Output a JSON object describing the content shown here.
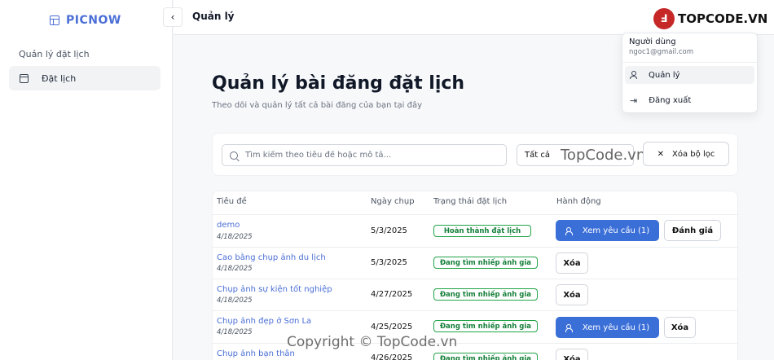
{
  "brand": {
    "name": "PICNOW",
    "icon": "layout-icon"
  },
  "sidebar": {
    "group_label": "Quản lý đặt lịch",
    "items": [
      {
        "label": "Đặt lịch",
        "icon": "calendar-icon"
      }
    ]
  },
  "topbar": {
    "title": "Quản lý",
    "collapse_icon": "chevron-left-icon"
  },
  "watermark": {
    "logo_text": "TOPCODE.VN",
    "logo_mark": "Ⅎ",
    "mid": "TopCode.vn",
    "copyright": "Copyright © TopCode.vn"
  },
  "page": {
    "title": "Quản lý bài đăng đặt lịch",
    "subtitle": "Theo dõi và quản lý tất cả bài đăng của bạn tại đây"
  },
  "filters": {
    "search_placeholder": "Tìm kiếm theo tiêu đề hoặc mô tả...",
    "status_value": "Tất cả",
    "clear_label": "Xóa bộ lọc"
  },
  "table": {
    "headers": [
      "Tiêu đề",
      "Ngày chụp",
      "Trạng thái đặt lịch",
      "Hành động"
    ],
    "rows": [
      {
        "title": "demo",
        "created": "4/18/2025",
        "shoot_date": "5/3/2025",
        "status": "Hoàn thành đặt lịch",
        "actions": [
          "Xem yêu cầu (1)",
          "Đánh giá"
        ]
      },
      {
        "title": "Cao bằng chụp ảnh du lịch",
        "created": "4/18/2025",
        "shoot_date": "5/3/2025",
        "status": "Đang tìm nhiếp ảnh gia",
        "actions": [
          "Xóa"
        ]
      },
      {
        "title": "Chụp ảnh sự kiện tốt nghiệp",
        "created": "4/18/2025",
        "shoot_date": "4/27/2025",
        "status": "Đang tìm nhiếp ảnh gia",
        "actions": [
          "Xóa"
        ]
      },
      {
        "title": "Chụp ảnh đẹp ở Sơn La",
        "created": "4/18/2025",
        "shoot_date": "4/25/2025",
        "status": "Đang tìm nhiếp ảnh gia",
        "actions": [
          "Xem yêu cầu (1)",
          "Xóa"
        ]
      },
      {
        "title": "Chụp ảnh bạn thân",
        "created": "",
        "shoot_date": "4/26/2025",
        "status": "Đang tìm nhiếp ảnh gia",
        "actions": [
          "Xóa"
        ]
      }
    ]
  },
  "user_menu": {
    "name": "Người dùng",
    "email": "ngoc1@gmail.com",
    "items": [
      {
        "label": "Quản lý",
        "icon": "user-icon"
      },
      {
        "label": "Đăng xuất",
        "icon": "logout-icon"
      }
    ]
  },
  "colors": {
    "primary": "#3b6fd8",
    "link": "#4b6fd6",
    "status_green": "#22a447"
  }
}
